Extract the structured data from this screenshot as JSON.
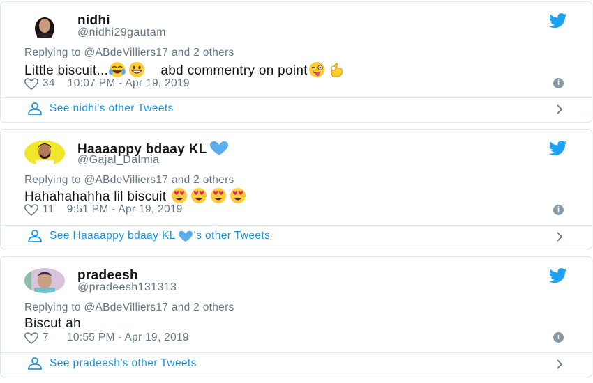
{
  "tweets": [
    {
      "name": "nidhi",
      "handle": "@nidhi29gautam",
      "replying_to": "Replying to @ABdeVilliers17 and 2 others",
      "text_a": "Little biscuit...",
      "text_b": "abd commentry on point",
      "likes": "34",
      "timestamp": "10:07 PM - Apr 19, 2019",
      "see_more": "See nidhi's other Tweets"
    },
    {
      "name": "Haaaappy bdaay KL",
      "handle": "@Gajal_Dalmia",
      "replying_to": "Replying to @ABdeVilliers17 and 2 others",
      "text_a": "Hahahahahha lil biscuit",
      "likes": "11",
      "timestamp": "9:51 PM - Apr 19, 2019",
      "see_more_a": "See Haaaappy bdaay KL",
      "see_more_b": "'s other Tweets"
    },
    {
      "name": "pradeesh",
      "handle": "@pradeesh131313",
      "replying_to": "Replying to @ABdeVilliers17 and 2 others",
      "text_a": "Biscut ah",
      "likes": "7",
      "timestamp": "10:55 PM - Apr 19, 2019",
      "see_more": "See pradeesh's other Tweets"
    }
  ],
  "colors": {
    "link": "#1b95e0",
    "muted": "#657786",
    "twitter_blue": "#1da1f2",
    "border": "#e1e8ed"
  },
  "icons": [
    "twitter-bird-icon",
    "heart-icon",
    "info-icon",
    "person-icon",
    "chevron-right-icon",
    "blue-heart-emoji",
    "laughing-emoji",
    "grinning-emoji",
    "winking-tongue-emoji",
    "ok-hand-emoji",
    "heart-eyes-emoji"
  ]
}
